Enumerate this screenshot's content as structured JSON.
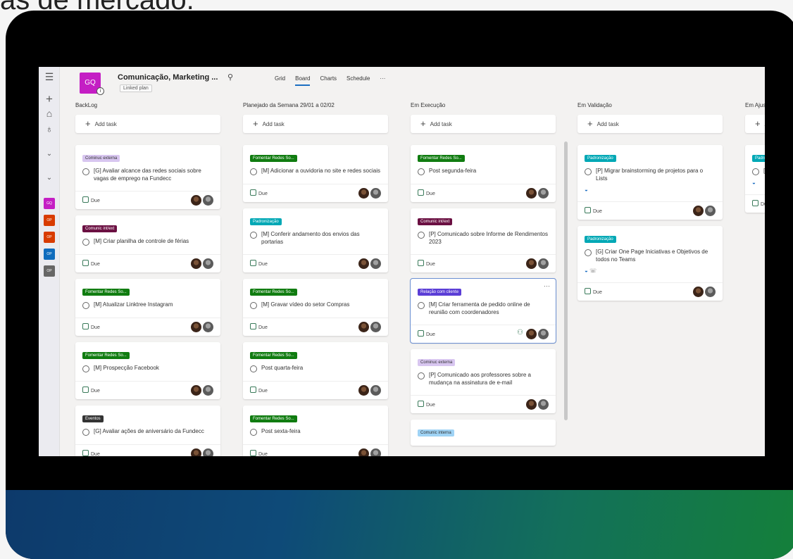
{
  "background_text": "as de mercado.",
  "colors": {
    "purple": "#c41ec4",
    "green": "#107c10",
    "maroon": "#6b1042",
    "teal": "#00a8b5",
    "lavender": "#d8c6f0",
    "violet": "#5b3ed6",
    "dark": "#333333",
    "lightblue": "#9fd3f5"
  },
  "rail": {
    "icons": [
      "hamburger-icon",
      "plus-icon",
      "home-icon",
      "people-icon",
      "chevron-down-icon",
      "chevron-down-icon"
    ],
    "plans": [
      {
        "label": "GQ",
        "color": "#c41ec4"
      },
      {
        "label": "OP",
        "color": "#d83b01"
      },
      {
        "label": "OP",
        "color": "#d83b01"
      },
      {
        "label": "OP",
        "color": "#0f6cbd"
      },
      {
        "label": "OP",
        "color": "#666666"
      }
    ]
  },
  "header": {
    "logo": "GQ",
    "title": "Comunicação, Marketing ...",
    "linked": "Linked plan",
    "tabs": [
      "Grid",
      "Board",
      "Charts",
      "Schedule",
      "···"
    ]
  },
  "add_task": "Add task",
  "due": "Due",
  "columns": [
    {
      "title": "BackLog",
      "cards": [
        {
          "label": "Cominuc externa",
          "label_color": "lavender",
          "task": "[G] Avaliar alcance das redes sociais sobre vagas de emprego na Fundecc"
        },
        {
          "label": "Comunic int/ext",
          "label_color": "maroon",
          "task": "[M] Criar planilha de controle de férias"
        },
        {
          "label": "Fomentar Redes So...",
          "label_color": "green",
          "task": "[M] Atualizar Linktree Instagram"
        },
        {
          "label": "Fomentar Redes So...",
          "label_color": "green",
          "task": "[M] Prospecção Facebook"
        },
        {
          "label": "Eventos",
          "label_color": "dark",
          "task": "[G] Avaliar ações de aniversário da Fundecc"
        }
      ]
    },
    {
      "title": "Planejado da Semana 29/01 a 02/02",
      "cards": [
        {
          "label": "Fomentar Redes So...",
          "label_color": "green",
          "task": "[M] Adicionar a ouvidoria no site e redes sociais"
        },
        {
          "label": "Padronização",
          "label_color": "teal",
          "task": "[M] Conferir andamento dos envios das portarias"
        },
        {
          "label": "Fomentar Redes So...",
          "label_color": "green",
          "task": "[M] Gravar vídeo do setor Compras"
        },
        {
          "label": "Fomentar Redes So...",
          "label_color": "green",
          "task": "Post quarta-feira"
        },
        {
          "label": "Fomentar Redes So...",
          "label_color": "green",
          "task": "Post sexta-feira"
        }
      ]
    },
    {
      "title": "Em Execução",
      "cards": [
        {
          "label": "Fomentar Redes So...",
          "label_color": "green",
          "task": "Post segunda-feira"
        },
        {
          "label": "Comunic int/ext",
          "label_color": "maroon",
          "task": "[P] Comunicado sobre Informe de Rendimentos 2023"
        },
        {
          "label": "Relação com cliente",
          "label_color": "violet",
          "task": "[M] Criar ferramenta de pedido online de reunião com coordenadores",
          "more": "···"
        },
        {
          "label": "Cominuc externa",
          "label_color": "lavender",
          "task": "[P] Comunicado aos professores sobre a mudança na assinatura de e-mail"
        },
        {
          "label": "Comunic interna",
          "label_color": "lightblue",
          "task": ""
        }
      ]
    },
    {
      "title": "Em Validação",
      "cards": [
        {
          "label": "Padronização",
          "label_color": "teal",
          "task": "[P] Migrar brainstorming de projetos para o Lists"
        },
        {
          "label": "Padronização",
          "label_color": "teal",
          "task": "[G] Criar One Page Iniciativas e Objetivos de todos no Teams"
        }
      ]
    },
    {
      "title": "Em Ajus",
      "cards": [
        {
          "label": "Padro",
          "label_color": "teal",
          "task": "[P] va"
        }
      ]
    }
  ]
}
